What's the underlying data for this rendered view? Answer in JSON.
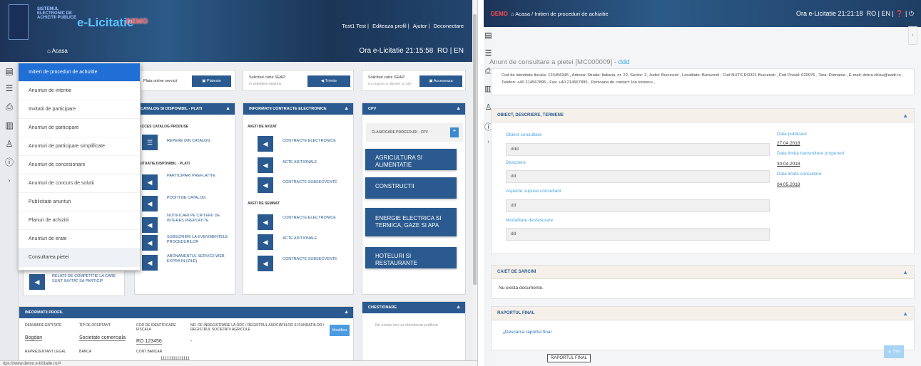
{
  "left": {
    "logo_text": "SISTEMUL ELECTRONIC DE ACHIZITII PUBLICE",
    "brand": "e-Licitatie",
    "demo": "DEMO",
    "top_links": [
      "Test1 Test",
      "Editeaza profil",
      "Ajutor",
      "Deconectare"
    ],
    "nav_home": "Acasa",
    "clock": "Ora e-Licitatie 21:15:58",
    "lang": [
      "RO",
      "EN"
    ],
    "menu": [
      "Initieri de proceduri de achizitie",
      "Anunturi de intentie",
      "Invitatii de participare",
      "Anunturi de participare",
      "Anunturi de participare simplificate",
      "Anunturi de concesionare",
      "Anunturi de concurs de solutii",
      "Publicitate anunturi",
      "Planuri de achizitii",
      "Anunturi de erate",
      "Consultarea pietei"
    ],
    "cta": {
      "plata_label": "Plata online servicii",
      "plata_btn": "Plateste",
      "sol_label": "Solicitari catre SEAP:",
      "sol_sub": "in asteptare raspuns",
      "trimite": "Trimite",
      "sol2_label": "Solicitari catre SEAP:",
      "sol2_sub": "(cu raspuns in ultimele 10 zile)",
      "acceseaza": "Acceseaza"
    },
    "catalog": {
      "title": "CATALOG SI DISPONIBIL - PLATI",
      "acces": "ACCES CATALOG PRODUSE",
      "repere": "REPERE DIN CATALOG",
      "situatie": "SITUATIE DISPONIBIL - PLATI",
      "items": [
        "PARTICIPARI PREFLATITE",
        "PODITI DE CATALOG",
        "NOTIFICARI PE CRITERII DE INTERES PREPLATITE",
        "SUBSCRIERI LA EVENIMENTELE PROCEDURILOR",
        "ABONAMENTUL SERVICII WEB EXPRA IN (ZILE)"
      ]
    },
    "contracte": {
      "title": "INFORMATII CONTRACTE ELECTRONICE",
      "avizat": "AVETI DE AVIZAT",
      "semnat": "AVETI DE SEMNAT",
      "items": [
        "CONTRACTE ELECTRONICE",
        "ACTE ADITIONALE",
        "CONTRACTE SUBSECVENTE"
      ]
    },
    "cpv": {
      "title": "CPV",
      "clasif": "CLASIFICARE PROCEDURI - CPV",
      "tiles": [
        "AGRICULTURA SI ALIMENTATIE",
        "CONSTRUCTII",
        "ENERGIE ELECTRICA SI TERMICA, GAZE SI APA",
        "HOTELURI SI RESTAURANTE"
      ]
    },
    "relatii": "RELATII DE COMPETITIE LA CARE SUNT INVITAT SA PARTICIP",
    "chestionare": {
      "title": "CHESTIONARE",
      "empty": "Nu exista nici un chestionar publicat"
    },
    "profil": {
      "title": "INFORMATII PROFIL",
      "h1": "DENUMIRE ENTITATE",
      "h2": "TIP DE OFERTANT",
      "h3": "COD DE IDENTIFICARE FISCALA",
      "h4": "NR. DE INREGISTRARE LA ORC / REGISTRUL ASOCIATIILOR SI FUNDATIILOR / REGISTRUL SOCIETATII AGRICOLE",
      "v1": "Bogdan",
      "v2": "Societate comerciala",
      "v3": "RO 123456",
      "v4": "-",
      "modifica": "Modifica",
      "h5": "REPREZENTANT LEGAL",
      "h6": "BANCA",
      "h7": "CONT BANCAR",
      "v7": "11111111111111"
    },
    "status": "ttps://www.demo.e-licitatie.ro/#"
  },
  "right": {
    "demo": "DEMO",
    "breadcrumb": "Acasa / Initieri de proceduri de achizitie",
    "clock": "Ora e-Licitatie 21:21:18",
    "lang": "RO | EN |",
    "title": "Anunt de consultare a pietei [MC000009] -",
    "title_suffix": "ddd",
    "contact": "Cod de identitate fiscala: 123456345 , Adresa: Strada: Italiana, nr. 22, Sector: 2, Judet: Bucuresti , Localitate: Bucuresti , Cod NUTS RO321 Bucuresti , Cod Postal: 020976 , Tara: Romania , E-mail: doina.chisu@aadr.ro , Telefon: +40 214567895 , Fax: +40 214567895 , Persoana de contact: Ion Ionescu ,",
    "obiect": {
      "title": "OBIECT, DESCRIERE, TERMENE",
      "f1": "Obiect consultare",
      "v1": "ddd",
      "f2": "Descriere",
      "v2": "dd",
      "f3": "Aspecte supuse consultarii",
      "v3": "dd",
      "f4": "Modalitate desfasurare",
      "v4": "dd",
      "d1": "Data publicare",
      "dv1": "27.04.2018",
      "d2": "Data limita transmitere propuneri",
      "dv2": "30.04.2018",
      "d3": "Data limita consultare",
      "dv3": "04.05.2018"
    },
    "caiet": {
      "title": "CAIET DE SARCINI",
      "empty": "Nu exista documente."
    },
    "raport": {
      "title": "RAPORTUL FINAL",
      "link": "Descarca raportul final",
      "tooltip": "RAPORTUL FINAL"
    },
    "sus": "Sus"
  }
}
